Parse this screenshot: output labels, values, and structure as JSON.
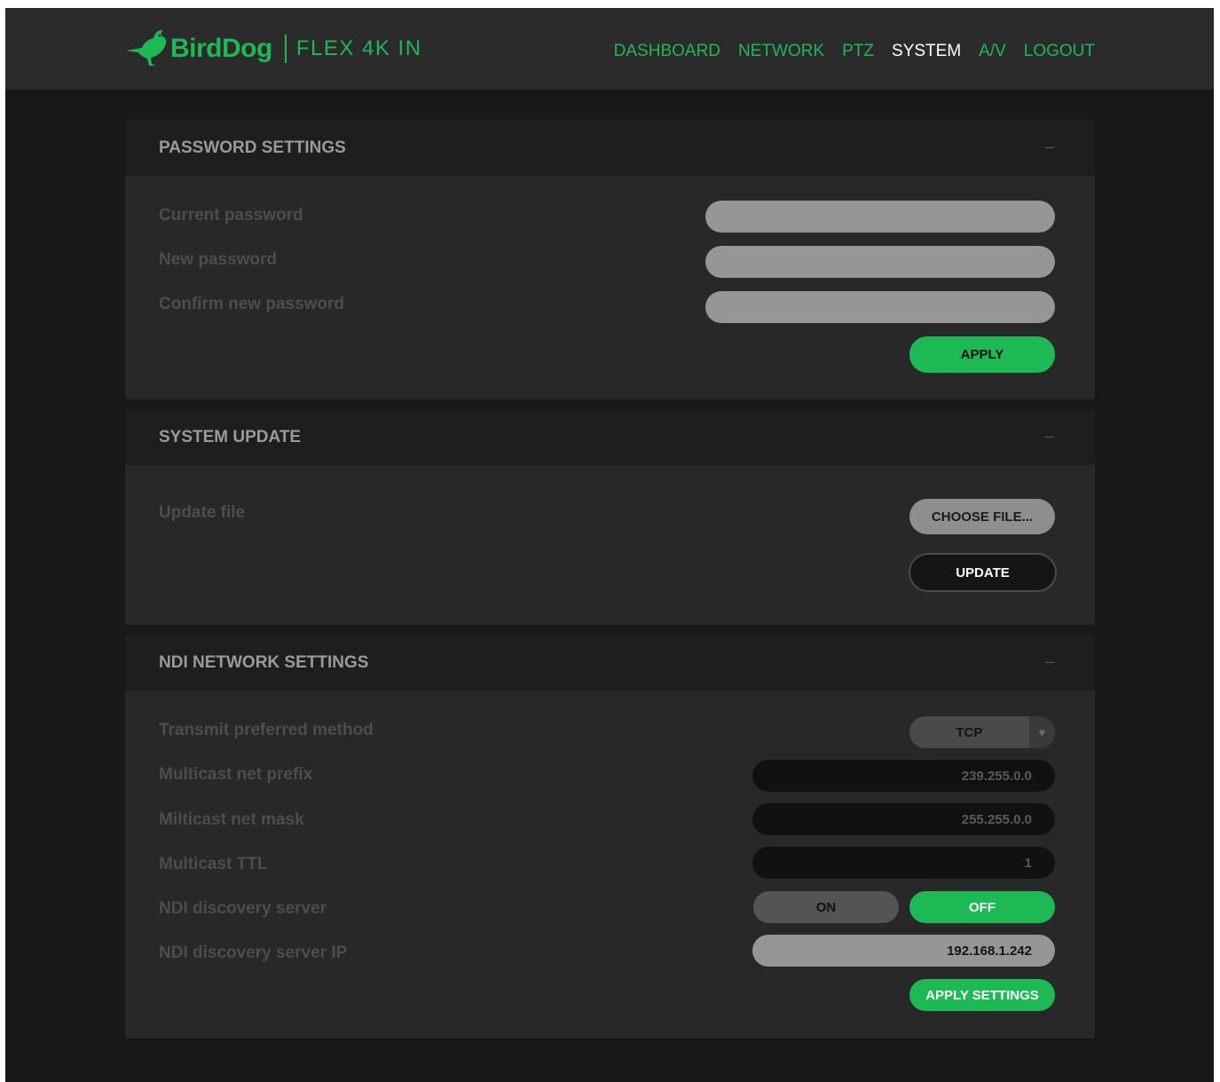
{
  "brand": {
    "name": "BirdDog",
    "model": "FLEX 4K IN",
    "color": "#1db954"
  },
  "nav": [
    {
      "label": "DASHBOARD",
      "active": false
    },
    {
      "label": "NETWORK",
      "active": false
    },
    {
      "label": "PTZ",
      "active": false
    },
    {
      "label": "SYSTEM",
      "active": true
    },
    {
      "label": "A/V",
      "active": false
    },
    {
      "label": "LOGOUT",
      "active": false
    }
  ],
  "password": {
    "title": "PASSWORD SETTINGS",
    "collapse": "–",
    "current_label": "Current password",
    "current_value": "",
    "new_label": "New password",
    "new_value": "",
    "confirm_label": "Confirm new password",
    "confirm_value": "",
    "apply": "APPLY"
  },
  "update": {
    "title": "SYSTEM UPDATE",
    "collapse": "–",
    "file_label": "Update file",
    "choose": "CHOOSE FILE...",
    "update": "UPDATE"
  },
  "ndi": {
    "title": "NDI NETWORK SETTINGS",
    "collapse": "–",
    "method_label": "Transmit preferred method",
    "method_value": "TCP",
    "method_arrow": "▼",
    "prefix_label": "Multicast net prefix",
    "prefix_value": "239.255.0.0",
    "mask_label": "Milticast net mask",
    "mask_value": "255.255.0.0",
    "ttl_label": "Multicast TTL",
    "ttl_value": "1",
    "discovery_label": "NDI discovery server",
    "discovery_on": "ON",
    "discovery_off": "OFF",
    "discovery_state": "OFF",
    "ip_label": "NDI discovery server IP",
    "ip_value": "192.168.1.242",
    "apply": "APPLY SETTINGS"
  }
}
